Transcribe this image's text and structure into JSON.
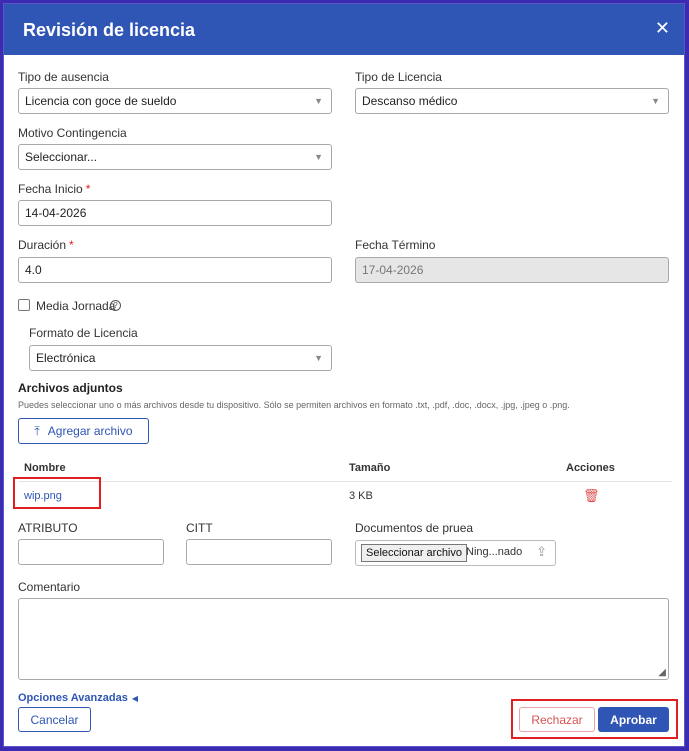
{
  "modal": {
    "title": "Revisión de licencia"
  },
  "form": {
    "tipo_ausencia": {
      "label": "Tipo de ausencia",
      "value": "Licencia con goce de sueldo"
    },
    "tipo_licencia": {
      "label": "Tipo de Licencia",
      "value": "Descanso médico"
    },
    "motivo_contingencia": {
      "label": "Motivo Contingencia",
      "value": "Seleccionar..."
    },
    "fecha_inicio": {
      "label": "Fecha Inicio",
      "required_mark": "*",
      "value": "14-04-2026"
    },
    "duracion": {
      "label": "Duración",
      "required_mark": "*",
      "value": "4.0"
    },
    "fecha_termino": {
      "label": "Fecha Término",
      "value": "17-04-2026"
    },
    "media_jornada": {
      "label": "Media Jornada",
      "checked": false,
      "help_icon": "question-circle-icon"
    },
    "formato_licencia": {
      "label": "Formato de Licencia",
      "value": "Electrónica"
    }
  },
  "attachments": {
    "title": "Archivos adjuntos",
    "hint": "Puedes seleccionar uno o más archivos desde tu dispositivo. Sólo se permiten archivos en formato .txt, .pdf, .doc, .docx, .jpg, .jpeg o .png.",
    "add_button": "Agregar archivo",
    "add_icon": "upload-arrow-icon",
    "columns": {
      "name": "Nombre",
      "size": "Tamaño",
      "actions": "Acciones"
    },
    "rows": [
      {
        "name": "wip.png",
        "size": "3 KB",
        "action_icon": "trash-icon"
      }
    ]
  },
  "extra": {
    "atributo": {
      "label": "ATRIBUTO",
      "value": ""
    },
    "citt": {
      "label": "CITT",
      "value": ""
    },
    "documentos": {
      "label": "Documentos de pruea",
      "choose_label": "Seleccionar archivo",
      "status": "Ning...nado"
    }
  },
  "comentario": {
    "label": "Comentario",
    "value": ""
  },
  "advanced": {
    "label": "Opciones Avanzadas"
  },
  "footer": {
    "cancel": "Cancelar",
    "reject": "Rechazar",
    "approve": "Aprobar"
  },
  "colors": {
    "primary": "#2f55b5",
    "reject": "#d75454",
    "highlight": "#e02020",
    "backdrop": "#3a2bb0"
  }
}
